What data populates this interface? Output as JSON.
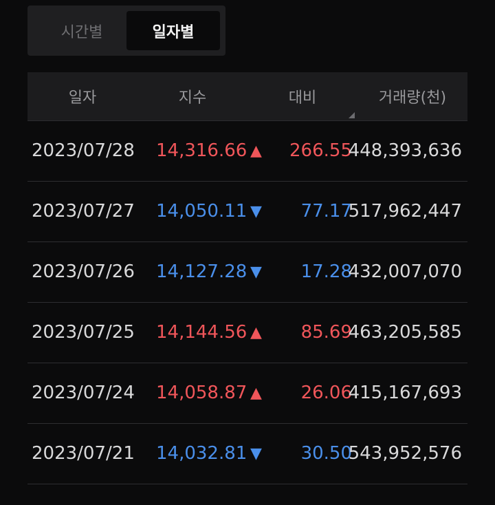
{
  "tabs": [
    {
      "label": "시간별",
      "active": false
    },
    {
      "label": "일자별",
      "active": true
    }
  ],
  "table": {
    "headers": {
      "date": "일자",
      "index": "지수",
      "diff": "대비",
      "volume": "거래량(천)"
    },
    "rows": [
      {
        "date": "2023/07/28",
        "index": "14,316.66",
        "arrow": "▲",
        "direction": "up",
        "diff": "266.55",
        "volume": "448,393,636"
      },
      {
        "date": "2023/07/27",
        "index": "14,050.11",
        "arrow": "▼",
        "direction": "down",
        "diff": "77.17",
        "volume": "517,962,447"
      },
      {
        "date": "2023/07/26",
        "index": "14,127.28",
        "arrow": "▼",
        "direction": "down",
        "diff": "17.28",
        "volume": "432,007,070"
      },
      {
        "date": "2023/07/25",
        "index": "14,144.56",
        "arrow": "▲",
        "direction": "up",
        "diff": "85.69",
        "volume": "463,205,585"
      },
      {
        "date": "2023/07/24",
        "index": "14,058.87",
        "arrow": "▲",
        "direction": "up",
        "diff": "26.06",
        "volume": "415,167,693"
      },
      {
        "date": "2023/07/21",
        "index": "14,032.81",
        "arrow": "▼",
        "direction": "down",
        "diff": "30.50",
        "volume": "543,952,576"
      }
    ]
  },
  "colors": {
    "up": "#f0565a",
    "down": "#4a8fea",
    "background": "#0b0b0c"
  }
}
